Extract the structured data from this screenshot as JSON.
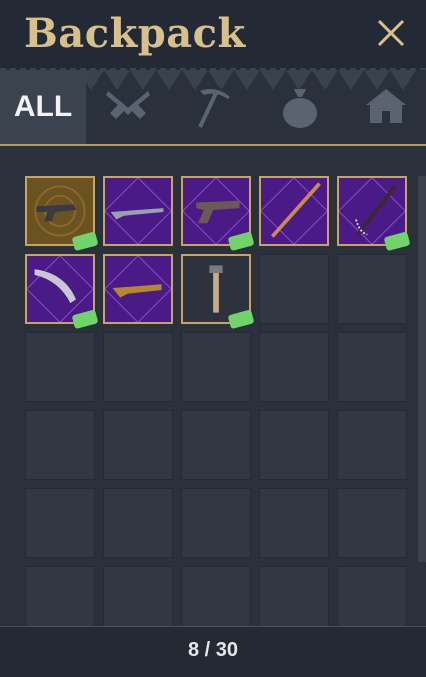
{
  "window": {
    "title": "Backpack",
    "close_icon": "close-icon"
  },
  "tabs": [
    {
      "label": "ALL",
      "selected": true
    },
    {
      "icon": "crossed-revolvers-icon"
    },
    {
      "icon": "pickaxe-icon"
    },
    {
      "icon": "money-bag-icon"
    },
    {
      "icon": "house-icon"
    }
  ],
  "inventory": {
    "items": [
      {
        "name": "revolver",
        "rarity": "gold",
        "new": true
      },
      {
        "name": "rifle",
        "rarity": "purple",
        "new": false
      },
      {
        "name": "pistol",
        "rarity": "purple",
        "new": true
      },
      {
        "name": "bow-rifle",
        "rarity": "purple",
        "new": false
      },
      {
        "name": "chain-rifle",
        "rarity": "purple",
        "new": true
      },
      {
        "name": "machete",
        "rarity": "purple",
        "new": true
      },
      {
        "name": "shotgun",
        "rarity": "purple",
        "new": false
      },
      {
        "name": "hammer",
        "rarity": "common",
        "new": true
      }
    ],
    "empty_slots": 22,
    "count_text": "8 / 30"
  },
  "colors": {
    "gold": "#c7a45f",
    "purple": "#4a1a86",
    "badge": "#6fd46a"
  }
}
